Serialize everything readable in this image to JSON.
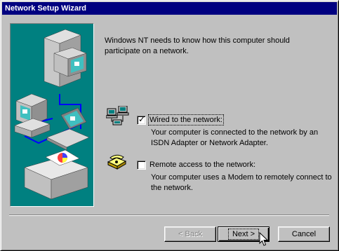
{
  "window": {
    "title": "Network Setup Wizard"
  },
  "intro_text": "Windows NT needs to know how this computer should participate on a network.",
  "options": [
    {
      "label": "Wired to the network:",
      "checked": true,
      "description": "Your computer is connected to the network by an ISDN Adapter or Network Adapter.",
      "icon": "network-computers-icon"
    },
    {
      "label": "Remote access to the network:",
      "checked": false,
      "description": "Your computer uses a Modem to remotely connect to the network.",
      "icon": "telephone-icon"
    }
  ],
  "buttons": {
    "back": "< Back",
    "next": "Next >",
    "cancel": "Cancel"
  },
  "colors": {
    "title_bar": "#000080",
    "illustration_bg": "#008080",
    "face": "#c0c0c0"
  }
}
